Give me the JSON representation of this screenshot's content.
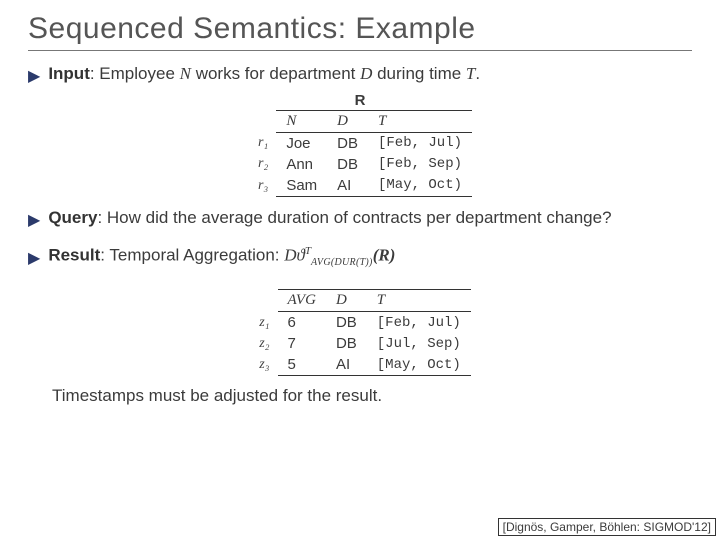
{
  "title": "Sequenced Semantics: Example",
  "bullets": {
    "input": {
      "label": "Input",
      "text_before": ": Employee ",
      "var1": "N",
      "text_mid1": " works for department ",
      "var2": "D",
      "text_mid2": " during time ",
      "var3": "T",
      "text_after": "."
    },
    "query": {
      "label": "Query",
      "text": ": How did the average duration of contracts per department change?"
    },
    "result": {
      "label": "Result",
      "text": ": Temporal Aggregation: "
    }
  },
  "formula": {
    "D": "D",
    "theta": "ϑ",
    "supT": "T",
    "sub": "AVG(DUR(T))",
    "arg": "(R)"
  },
  "relation_R": {
    "name": "R",
    "headers": {
      "c1": "N",
      "c2": "D",
      "c3": "T"
    },
    "rows": [
      {
        "id": "r₁",
        "n": "Joe",
        "d": "DB",
        "t": "[Feb, Jul)"
      },
      {
        "id": "r₂",
        "n": "Ann",
        "d": "DB",
        "t": "[Feb, Sep)"
      },
      {
        "id": "r₃",
        "n": "Sam",
        "d": "AI",
        "t": "[May, Oct)"
      }
    ]
  },
  "relation_Z": {
    "headers": {
      "c1": "AVG",
      "c2": "D",
      "c3": "T"
    },
    "rows": [
      {
        "id": "z₁",
        "avg": "6",
        "d": "DB",
        "t": "[Feb, Jul)"
      },
      {
        "id": "z₂",
        "avg": "7",
        "d": "DB",
        "t": "[Jul, Sep)"
      },
      {
        "id": "z₃",
        "avg": "5",
        "d": "AI",
        "t": "[May, Oct)"
      }
    ]
  },
  "footer_note": "Timestamps must be adjusted for the result.",
  "citation": "[Dignös, Gamper, Böhlen: SIGMOD'12]"
}
